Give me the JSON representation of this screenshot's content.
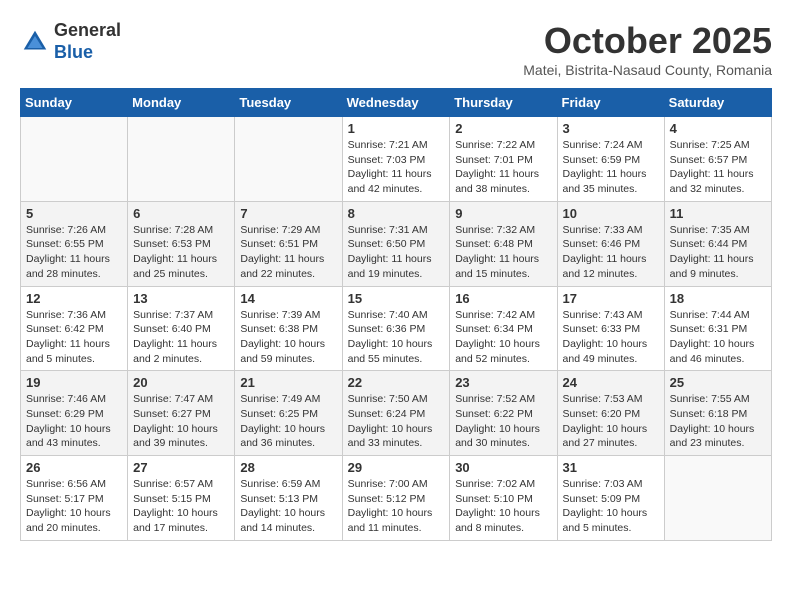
{
  "header": {
    "logo_line1": "General",
    "logo_line2": "Blue",
    "month_title": "October 2025",
    "subtitle": "Matei, Bistrita-Nasaud County, Romania"
  },
  "days_of_week": [
    "Sunday",
    "Monday",
    "Tuesday",
    "Wednesday",
    "Thursday",
    "Friday",
    "Saturday"
  ],
  "weeks": [
    [
      {
        "day": "",
        "info": ""
      },
      {
        "day": "",
        "info": ""
      },
      {
        "day": "",
        "info": ""
      },
      {
        "day": "1",
        "info": "Sunrise: 7:21 AM\nSunset: 7:03 PM\nDaylight: 11 hours and 42 minutes."
      },
      {
        "day": "2",
        "info": "Sunrise: 7:22 AM\nSunset: 7:01 PM\nDaylight: 11 hours and 38 minutes."
      },
      {
        "day": "3",
        "info": "Sunrise: 7:24 AM\nSunset: 6:59 PM\nDaylight: 11 hours and 35 minutes."
      },
      {
        "day": "4",
        "info": "Sunrise: 7:25 AM\nSunset: 6:57 PM\nDaylight: 11 hours and 32 minutes."
      }
    ],
    [
      {
        "day": "5",
        "info": "Sunrise: 7:26 AM\nSunset: 6:55 PM\nDaylight: 11 hours and 28 minutes."
      },
      {
        "day": "6",
        "info": "Sunrise: 7:28 AM\nSunset: 6:53 PM\nDaylight: 11 hours and 25 minutes."
      },
      {
        "day": "7",
        "info": "Sunrise: 7:29 AM\nSunset: 6:51 PM\nDaylight: 11 hours and 22 minutes."
      },
      {
        "day": "8",
        "info": "Sunrise: 7:31 AM\nSunset: 6:50 PM\nDaylight: 11 hours and 19 minutes."
      },
      {
        "day": "9",
        "info": "Sunrise: 7:32 AM\nSunset: 6:48 PM\nDaylight: 11 hours and 15 minutes."
      },
      {
        "day": "10",
        "info": "Sunrise: 7:33 AM\nSunset: 6:46 PM\nDaylight: 11 hours and 12 minutes."
      },
      {
        "day": "11",
        "info": "Sunrise: 7:35 AM\nSunset: 6:44 PM\nDaylight: 11 hours and 9 minutes."
      }
    ],
    [
      {
        "day": "12",
        "info": "Sunrise: 7:36 AM\nSunset: 6:42 PM\nDaylight: 11 hours and 5 minutes."
      },
      {
        "day": "13",
        "info": "Sunrise: 7:37 AM\nSunset: 6:40 PM\nDaylight: 11 hours and 2 minutes."
      },
      {
        "day": "14",
        "info": "Sunrise: 7:39 AM\nSunset: 6:38 PM\nDaylight: 10 hours and 59 minutes."
      },
      {
        "day": "15",
        "info": "Sunrise: 7:40 AM\nSunset: 6:36 PM\nDaylight: 10 hours and 55 minutes."
      },
      {
        "day": "16",
        "info": "Sunrise: 7:42 AM\nSunset: 6:34 PM\nDaylight: 10 hours and 52 minutes."
      },
      {
        "day": "17",
        "info": "Sunrise: 7:43 AM\nSunset: 6:33 PM\nDaylight: 10 hours and 49 minutes."
      },
      {
        "day": "18",
        "info": "Sunrise: 7:44 AM\nSunset: 6:31 PM\nDaylight: 10 hours and 46 minutes."
      }
    ],
    [
      {
        "day": "19",
        "info": "Sunrise: 7:46 AM\nSunset: 6:29 PM\nDaylight: 10 hours and 43 minutes."
      },
      {
        "day": "20",
        "info": "Sunrise: 7:47 AM\nSunset: 6:27 PM\nDaylight: 10 hours and 39 minutes."
      },
      {
        "day": "21",
        "info": "Sunrise: 7:49 AM\nSunset: 6:25 PM\nDaylight: 10 hours and 36 minutes."
      },
      {
        "day": "22",
        "info": "Sunrise: 7:50 AM\nSunset: 6:24 PM\nDaylight: 10 hours and 33 minutes."
      },
      {
        "day": "23",
        "info": "Sunrise: 7:52 AM\nSunset: 6:22 PM\nDaylight: 10 hours and 30 minutes."
      },
      {
        "day": "24",
        "info": "Sunrise: 7:53 AM\nSunset: 6:20 PM\nDaylight: 10 hours and 27 minutes."
      },
      {
        "day": "25",
        "info": "Sunrise: 7:55 AM\nSunset: 6:18 PM\nDaylight: 10 hours and 23 minutes."
      }
    ],
    [
      {
        "day": "26",
        "info": "Sunrise: 6:56 AM\nSunset: 5:17 PM\nDaylight: 10 hours and 20 minutes."
      },
      {
        "day": "27",
        "info": "Sunrise: 6:57 AM\nSunset: 5:15 PM\nDaylight: 10 hours and 17 minutes."
      },
      {
        "day": "28",
        "info": "Sunrise: 6:59 AM\nSunset: 5:13 PM\nDaylight: 10 hours and 14 minutes."
      },
      {
        "day": "29",
        "info": "Sunrise: 7:00 AM\nSunset: 5:12 PM\nDaylight: 10 hours and 11 minutes."
      },
      {
        "day": "30",
        "info": "Sunrise: 7:02 AM\nSunset: 5:10 PM\nDaylight: 10 hours and 8 minutes."
      },
      {
        "day": "31",
        "info": "Sunrise: 7:03 AM\nSunset: 5:09 PM\nDaylight: 10 hours and 5 minutes."
      },
      {
        "day": "",
        "info": ""
      }
    ]
  ]
}
